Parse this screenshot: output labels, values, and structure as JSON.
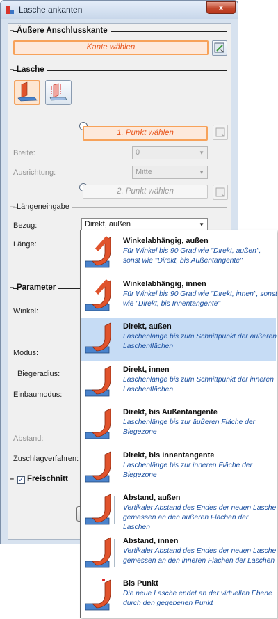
{
  "window": {
    "title": "Lasche ankanten",
    "close_symbol": "x"
  },
  "section_edge": {
    "title": "Äußere Anschlusskante",
    "pick_label": "Kante wählen"
  },
  "section_flap": {
    "title": "Lasche",
    "point1_label": "1. Punkt wählen",
    "width_label": "Breite:",
    "width_value": "0",
    "orientation_label": "Ausrichtung:",
    "orientation_value": "Mitte",
    "point2_label": "2. Punkt wählen"
  },
  "length_input": {
    "title": "Längeneingabe",
    "reference_label": "Bezug:",
    "reference_value": "Direkt, außen",
    "length_label": "Länge:"
  },
  "section_params": {
    "title": "Parameter",
    "angle_label": "Winkel:",
    "mode_label": "Modus:",
    "bend_radius_label": "Biegeradius:",
    "install_mode_label": "Einbaumodus:",
    "distance_label": "Abstand:",
    "allowance_label": "Zuschlagverfahren:"
  },
  "section_relief": {
    "title": "Freischnitt",
    "checked": true,
    "check_glyph": "✓"
  },
  "dropdown_options": [
    {
      "title": "Winkelabhängig, außen",
      "desc": "Für Winkel bis 90 Grad wie \"Direkt, außen\", sonst wie \"Direkt, bis Außentangente\""
    },
    {
      "title": "Winkelabhängig, innen",
      "desc": "Für Winkel bis 90 Grad wie \"Direkt, innen\", sonst wie \"Direkt, bis Innentangente\""
    },
    {
      "title": "Direkt, außen",
      "desc": "Laschenlänge bis zum Schnittpunkt der äußeren Laschenflächen",
      "selected": true
    },
    {
      "title": "Direkt, innen",
      "desc": "Laschenlänge bis zum Schnittpunkt der inneren Laschenflächen"
    },
    {
      "title": "Direkt, bis Außentangente",
      "desc": "Laschenlänge bis zur äußeren Fläche der Biegezone"
    },
    {
      "title": "Direkt, bis Innentangente",
      "desc": "Laschenlänge bis zur inneren Fläche der Biegezone"
    },
    {
      "title": "Abstand, außen",
      "desc": "Vertikaler Abstand des Endes der neuen Lasche gemessen an den äußeren Flächen der Laschen"
    },
    {
      "title": "Abstand, innen",
      "desc": "Vertikaler Abstand des Endes der neuen Lasche gemessen an den inneren Flächen der Laschen"
    },
    {
      "title": "Bis Punkt",
      "desc": "Die neue Lasche endet an der virtuellen Ebene durch den gegebenen Punkt"
    }
  ],
  "colors": {
    "accent_orange": "#e8571e",
    "selection_blue": "#c6dcf5",
    "desc_blue": "#1a4fa0"
  }
}
